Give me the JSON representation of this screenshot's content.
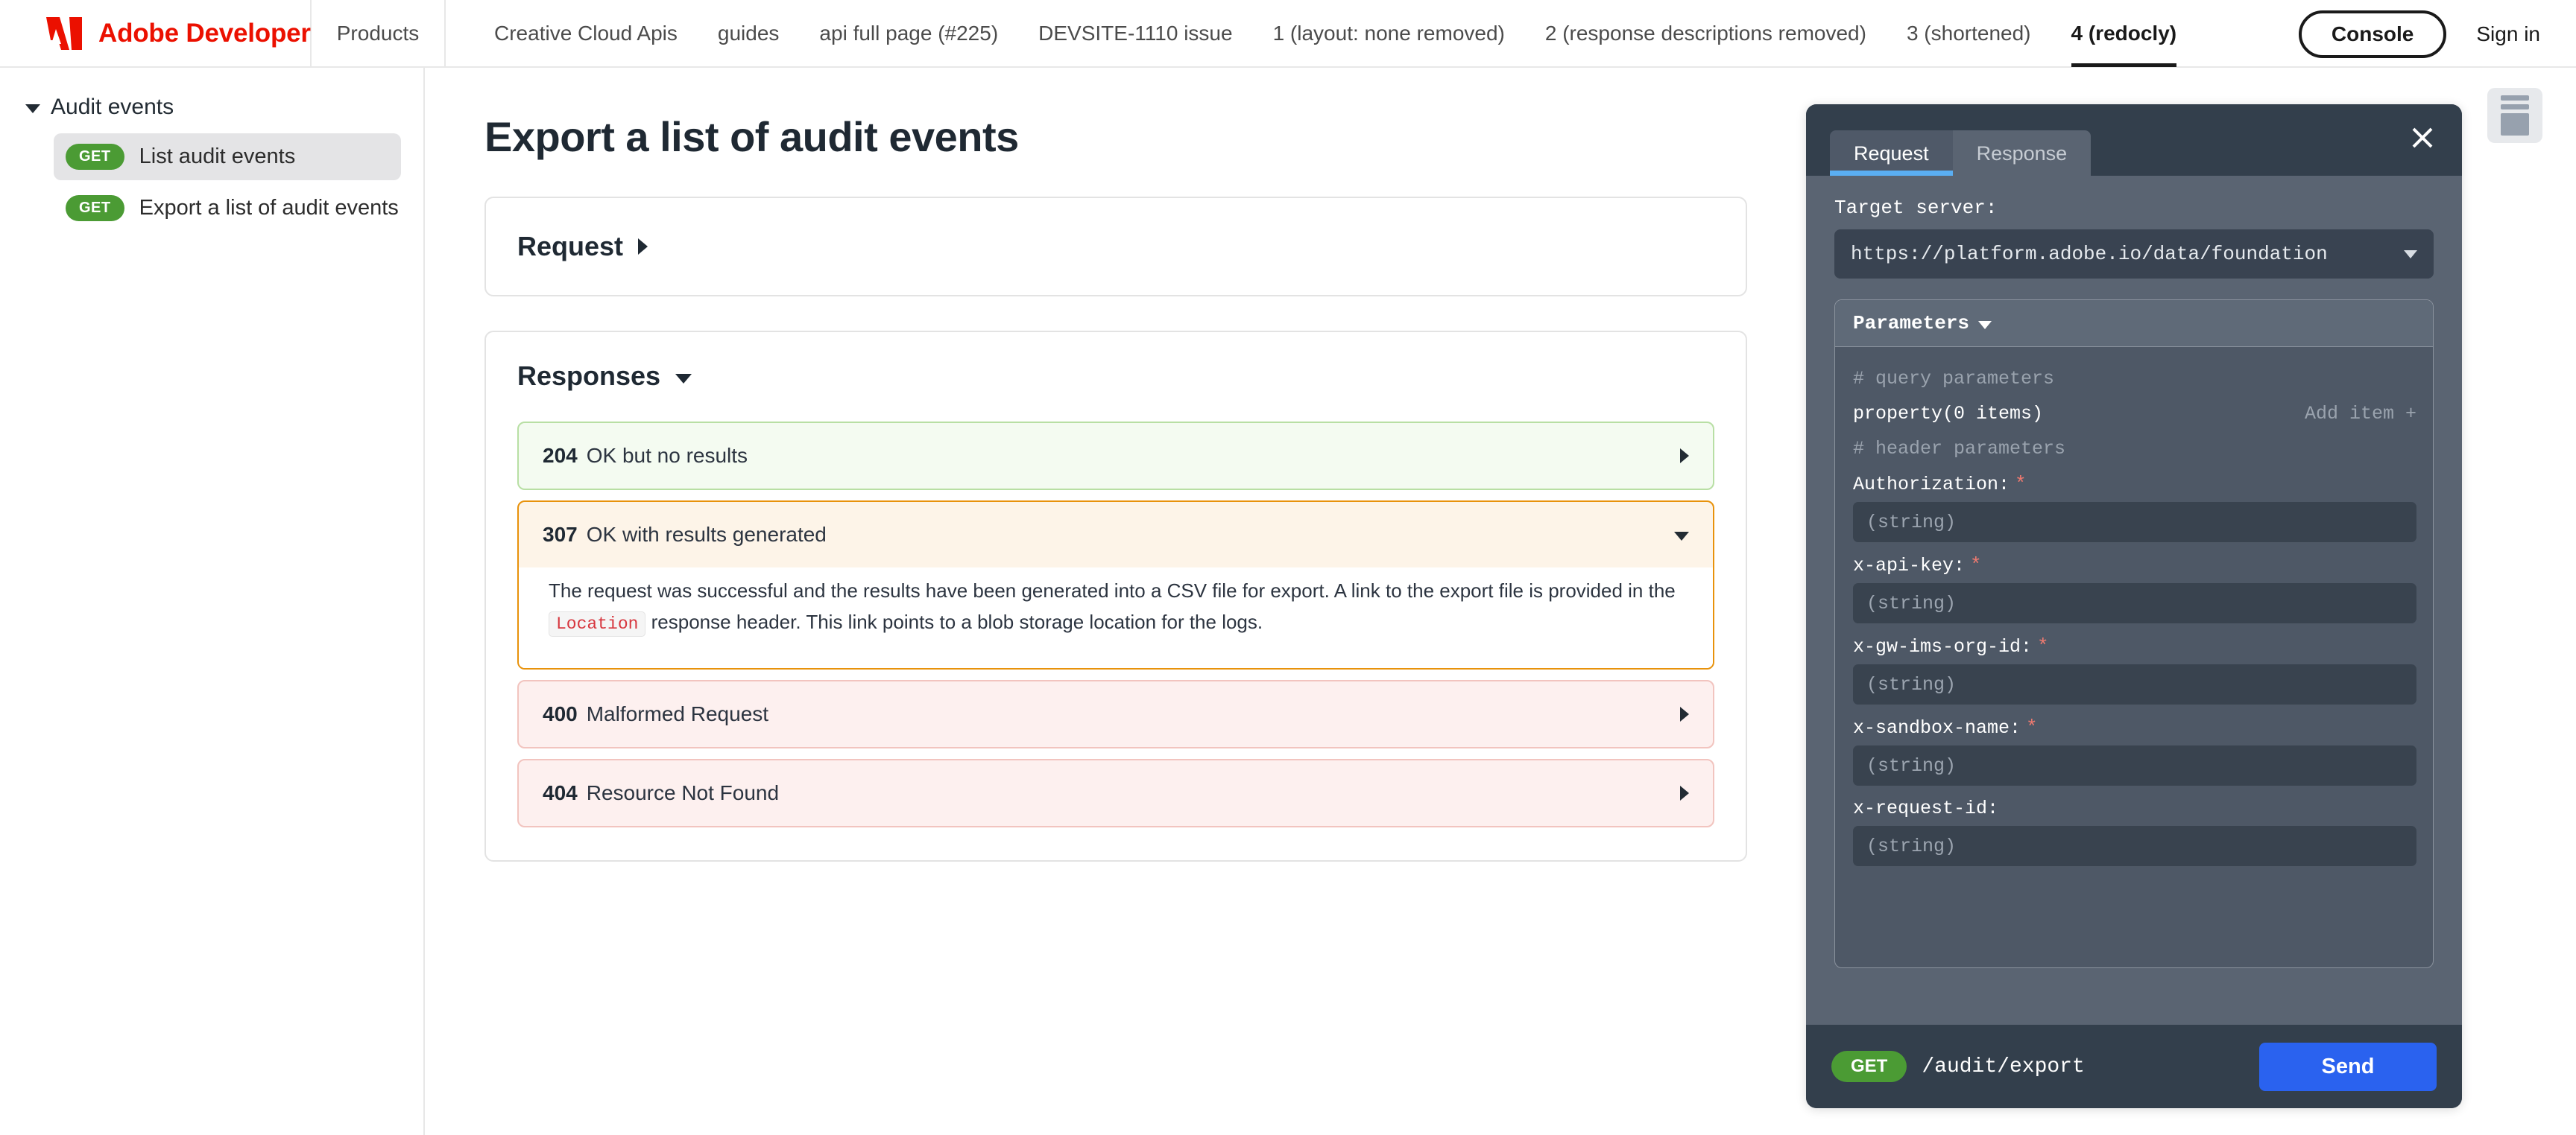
{
  "header": {
    "brand": "Adobe Developer",
    "logo_icon": "adobe-logo-icon",
    "products_label": "Products",
    "tabs": [
      {
        "label": "Creative Cloud Apis",
        "active": false
      },
      {
        "label": "guides",
        "active": false
      },
      {
        "label": "api full page (#225)",
        "active": false
      },
      {
        "label": "DEVSITE-1110 issue",
        "active": false
      },
      {
        "label": "1 (layout: none removed)",
        "active": false
      },
      {
        "label": "2 (response descriptions removed)",
        "active": false
      },
      {
        "label": "3 (shortened)",
        "active": false
      },
      {
        "label": "4 (redocly)",
        "active": true
      }
    ],
    "console_label": "Console",
    "signin_label": "Sign in"
  },
  "sidebar": {
    "group_label": "Audit events",
    "group_chevron_icon": "chevron-down-icon",
    "items": [
      {
        "method": "GET",
        "label": "List audit events",
        "active": true
      },
      {
        "method": "GET",
        "label": "Export a list of audit events",
        "active": false
      }
    ]
  },
  "main": {
    "title": "Export a list of audit events",
    "request_card": {
      "label": "Request",
      "chevron_icon": "chevron-right-icon"
    },
    "responses_card": {
      "label": "Responses",
      "chevron_icon": "chevron-down-icon",
      "rows": [
        {
          "code": "204",
          "text": "OK but no results",
          "tone": "green",
          "expanded": false,
          "chevron_icon": "chevron-right-icon",
          "body_parts": []
        },
        {
          "code": "307",
          "text": "OK with results generated",
          "tone": "orange",
          "expanded": true,
          "chevron_icon": "chevron-down-icon",
          "body_parts": [
            {
              "type": "text",
              "value": "The request was successful and the results have been generated into a CSV file for export. A link to the export file is provided in the "
            },
            {
              "type": "code",
              "value": "Location"
            },
            {
              "type": "text",
              "value": " response header. This link points to a blob storage location for the logs."
            }
          ]
        },
        {
          "code": "400",
          "text": "Malformed Request",
          "tone": "red",
          "expanded": false,
          "chevron_icon": "chevron-right-icon",
          "body_parts": []
        },
        {
          "code": "404",
          "text": "Resource Not Found",
          "tone": "red",
          "expanded": false,
          "chevron_icon": "chevron-right-icon",
          "body_parts": []
        }
      ]
    }
  },
  "try_panel": {
    "tabs": [
      {
        "label": "Request",
        "active": true
      },
      {
        "label": "Response",
        "active": false
      }
    ],
    "close_icon": "close-icon",
    "target_server_label": "Target server:",
    "target_server_value": "https://platform.adobe.io/data/foundation",
    "target_server_chevron_icon": "chevron-down-icon",
    "parameters_label": "Parameters",
    "parameters_chevron_icon": "chevron-down-icon",
    "query_comment": "# query parameters",
    "property_row_label": "property(0 items)",
    "add_item_label": "Add item +",
    "header_comment": "# header parameters",
    "fields": [
      {
        "name": "Authorization:",
        "required": true,
        "placeholder": "(string)"
      },
      {
        "name": "x-api-key:",
        "required": true,
        "placeholder": "(string)"
      },
      {
        "name": "x-gw-ims-org-id:",
        "required": true,
        "placeholder": "(string)"
      },
      {
        "name": "x-sandbox-name:",
        "required": true,
        "placeholder": "(string)"
      },
      {
        "name": "x-request-id:",
        "required": false,
        "placeholder": "(string)"
      }
    ],
    "footer": {
      "method": "GET",
      "path": "/audit/export",
      "send_label": "Send"
    }
  },
  "panel_toggle": {
    "icon": "layout-panel-icon"
  },
  "colors": {
    "brand_red": "#EB1000",
    "get_green": "#4b9b34",
    "send_blue": "#2a62ef",
    "tab_accent": "#5aaef2",
    "required_star": "#ef7a70",
    "code_red": "#d7373f",
    "resp_green_border": "#b8dfa4",
    "resp_orange_border": "#e8920b",
    "resp_red_border": "#f2c4bf"
  }
}
